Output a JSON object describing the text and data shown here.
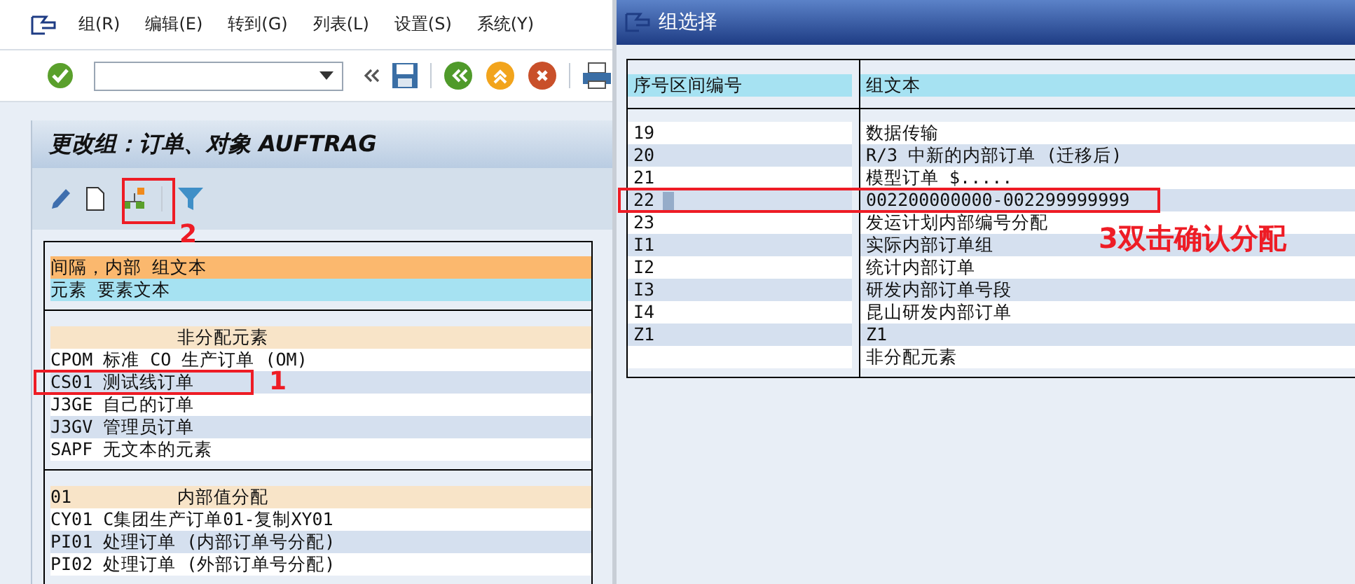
{
  "main_window": {
    "menu": [
      "组(R)",
      "编辑(E)",
      "转到(G)",
      "列表(L)",
      "设置(S)",
      "系统(Y)"
    ],
    "title": "更改组：订单、对象 AUFTRAG",
    "toolbar_annotation": "2",
    "legend": [
      {
        "kind": "group",
        "text": "间隔，内部 组文本"
      },
      {
        "kind": "element",
        "text": "元素 要素文本"
      }
    ],
    "sections": [
      {
        "header": {
          "text": "非分配元素"
        },
        "rows": [
          {
            "text": "CPOM 标准 CO 生产订单 (OM)"
          },
          {
            "text": "CS01 测试线订单",
            "annotation": "1"
          },
          {
            "text": "J3GE 自己的订单"
          },
          {
            "text": "J3GV 管理员订单"
          },
          {
            "text": "SAPF 无文本的元素"
          }
        ]
      },
      {
        "header": {
          "code": "01",
          "text": "内部值分配"
        },
        "rows": [
          {
            "text": "CY01 C集团生产订单01-复制XY01"
          },
          {
            "text": "PI01 处理订单 (内部订单号分配)"
          },
          {
            "text": "PI02 处理订单 (外部订单号分配)"
          }
        ]
      }
    ]
  },
  "dialog": {
    "title": "组选择",
    "columns": [
      "序号区间编号",
      "组文本"
    ],
    "rows": [
      {
        "number": "19",
        "text": "数据传输",
        "selected": false
      },
      {
        "number": "20",
        "text": "R/3 中新的内部订单 (迁移后)",
        "selected": false
      },
      {
        "number": "21",
        "text": "模型订单 $.....",
        "selected": false
      },
      {
        "number": "22",
        "text": "002200000000-002299999999",
        "selected": true,
        "annotation": "3双击确认分配"
      },
      {
        "number": "23",
        "text": "发运计划内部编号分配",
        "selected": false
      },
      {
        "number": "I1",
        "text": "实际内部订单组",
        "selected": false
      },
      {
        "number": "I2",
        "text": "统计内部订单",
        "selected": false
      },
      {
        "number": "I3",
        "text": "研发内部订单号段",
        "selected": false
      },
      {
        "number": "I4",
        "text": "昆山研发内部订单",
        "selected": false
      },
      {
        "number": "Z1",
        "text": "Z1",
        "selected": false
      },
      {
        "text": "非分配元素",
        "selected": false
      }
    ]
  }
}
